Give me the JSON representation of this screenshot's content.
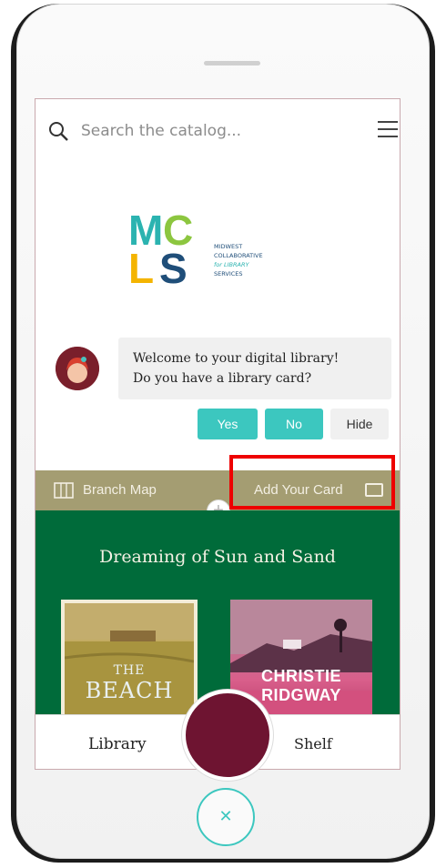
{
  "search": {
    "placeholder": "Search the catalog..."
  },
  "logo": {
    "letters": "MCLS",
    "name": "MIDWEST COLLABORATIVE for LIBRARY SERVICES"
  },
  "chat": {
    "message_line1": "Welcome to your digital library!",
    "message_line2": "Do you have a library card?",
    "yes_label": "Yes",
    "no_label": "No",
    "hide_label": "Hide"
  },
  "branch_bar": {
    "branch_map_label": "Branch Map",
    "add_card_label": "Add Your Card"
  },
  "collection": {
    "title": "Dreaming of Sun and Sand",
    "books": [
      {
        "cover_text_small": "THE",
        "cover_text_large": "BEACH"
      },
      {
        "cover_author": "CHRISTIE RIDGWAY"
      }
    ]
  },
  "bottom_nav": {
    "library_label": "Library",
    "shelf_label": "Shelf"
  },
  "colors": {
    "teal": "#3cc7bf",
    "maroon": "#6e1431",
    "green": "#006b3a",
    "olive": "#a49d72",
    "highlight": "#ee0000"
  },
  "icons": [
    "search-icon",
    "menu-icon",
    "map-icon",
    "card-icon",
    "plus-icon",
    "close-icon"
  ]
}
